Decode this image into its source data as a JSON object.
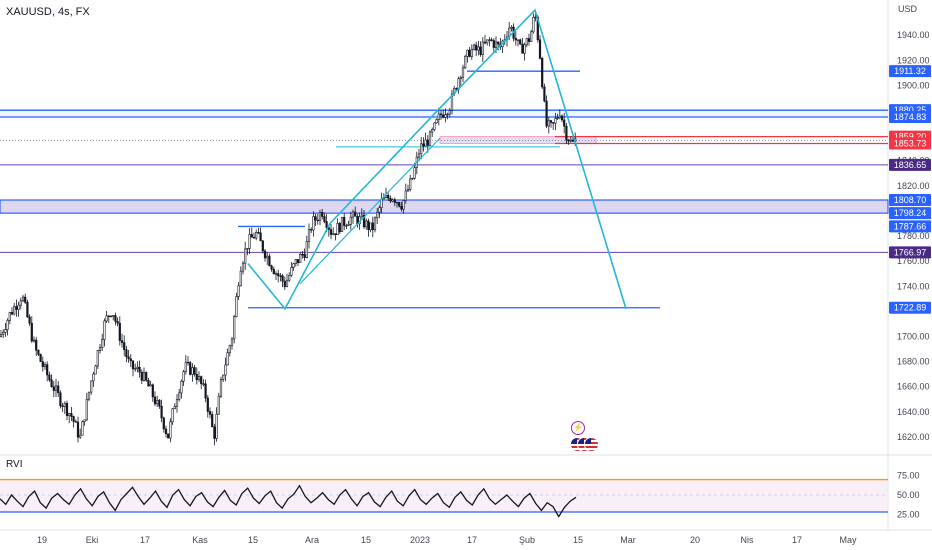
{
  "header": {
    "symbol_line": "XAUUSD, 4s, FX"
  },
  "currency_label": "USD",
  "indicator": {
    "name": "RVI"
  },
  "icons": [
    "lightning-icon",
    "us-flag-icon"
  ],
  "colors": {
    "candle": "#131722",
    "trend": "#22b7d9",
    "level_blue": "#2962ff",
    "level_red": "#f23645",
    "level_purple": "#6a3fb1",
    "zone_fill": "#d1c4e9",
    "rvi_line": "#131722",
    "rvi_upper": "#ff9800",
    "rvi_lower": "#2962ff"
  },
  "chart_data": {
    "type": "candlestick",
    "title": "XAUUSD, 4s, FX",
    "ylabel": "USD",
    "ylim": [
      1608,
      1968
    ],
    "y_ticks": [
      1620,
      1640,
      1660,
      1680,
      1700,
      1720,
      1740,
      1760,
      1780,
      1800,
      1820,
      1840,
      1860,
      1880,
      1900,
      1920,
      1940
    ],
    "y_tick_labels": [
      "1620.00",
      "1640.00",
      "1660.00",
      "1680.00",
      "1700.00",
      "",
      "1740.00",
      "1760.00",
      "1780.00",
      "",
      "1820.00",
      "1840.00",
      "",
      "",
      "1900.00",
      "1920.00",
      "1940.00"
    ],
    "x_ticks": [
      "19",
      "Eki",
      "17",
      "Kas",
      "15",
      "Ara",
      "15",
      "2023",
      "17",
      "Şub",
      "15",
      "Mar",
      "20",
      "Nis",
      "17",
      "May"
    ],
    "price_path": [
      [
        0,
        1700
      ],
      [
        10,
        1718
      ],
      [
        22,
        1733
      ],
      [
        35,
        1690
      ],
      [
        48,
        1668
      ],
      [
        60,
        1650
      ],
      [
        72,
        1636
      ],
      [
        80,
        1619
      ],
      [
        92,
        1668
      ],
      [
        105,
        1712
      ],
      [
        112,
        1722
      ],
      [
        120,
        1700
      ],
      [
        130,
        1676
      ],
      [
        140,
        1672
      ],
      [
        150,
        1658
      ],
      [
        160,
        1640
      ],
      [
        168,
        1620
      ],
      [
        175,
        1648
      ],
      [
        185,
        1676
      ],
      [
        195,
        1672
      ],
      [
        205,
        1655
      ],
      [
        214,
        1620
      ],
      [
        222,
        1668
      ],
      [
        232,
        1700
      ],
      [
        240,
        1755
      ],
      [
        248,
        1775
      ],
      [
        256,
        1782
      ],
      [
        265,
        1767
      ],
      [
        275,
        1752
      ],
      [
        285,
        1742
      ],
      [
        295,
        1758
      ],
      [
        305,
        1768
      ],
      [
        312,
        1790
      ],
      [
        322,
        1800
      ],
      [
        332,
        1782
      ],
      [
        342,
        1790
      ],
      [
        352,
        1795
      ],
      [
        362,
        1792
      ],
      [
        372,
        1785
      ],
      [
        382,
        1808
      ],
      [
        392,
        1812
      ],
      [
        402,
        1805
      ],
      [
        412,
        1825
      ],
      [
        420,
        1850
      ],
      [
        430,
        1858
      ],
      [
        440,
        1876
      ],
      [
        450,
        1884
      ],
      [
        460,
        1910
      ],
      [
        470,
        1928
      ],
      [
        480,
        1928
      ],
      [
        490,
        1936
      ],
      [
        500,
        1930
      ],
      [
        510,
        1948
      ],
      [
        520,
        1928
      ],
      [
        530,
        1938
      ],
      [
        535,
        1958
      ],
      [
        540,
        1924
      ],
      [
        546,
        1868
      ],
      [
        552,
        1866
      ],
      [
        560,
        1880
      ],
      [
        566,
        1862
      ],
      [
        572,
        1853
      ],
      [
        576,
        1857
      ]
    ],
    "levels": [
      {
        "value": 1911.32,
        "label": "1911.32",
        "kind": "line-blue"
      },
      {
        "value": 1880.25,
        "label": "1880.25",
        "kind": "line-blue"
      },
      {
        "value": 1874.83,
        "label": "1874.83",
        "kind": "line-blue"
      },
      {
        "value": 1859.2,
        "label": "1859.20",
        "kind": "line-red"
      },
      {
        "value": 1853.73,
        "label": "1853.73",
        "kind": "line-red"
      },
      {
        "value": 1836.65,
        "label": "1836.65",
        "kind": "line-purple"
      },
      {
        "value": 1808.7,
        "label": "1808.70",
        "kind": "zone-top"
      },
      {
        "value": 1798.24,
        "label": "1798.24",
        "kind": "zone-bottom"
      },
      {
        "value": 1787.66,
        "label": "1787.66",
        "kind": "line-blue"
      },
      {
        "value": 1766.97,
        "label": "1766.97",
        "kind": "line-purple"
      },
      {
        "value": 1722.89,
        "label": "1722.89",
        "kind": "line-blue"
      }
    ],
    "pattern_lines": [
      [
        [
          248,
          1758
        ],
        [
          285,
          1722
        ],
        [
          330,
          1790
        ],
        [
          440,
          1882
        ],
        [
          535,
          1960
        ],
        [
          626,
          1722
        ]
      ]
    ],
    "rvi": {
      "ylim": [
        15,
        85
      ],
      "ticks": [
        75,
        50,
        25
      ],
      "tick_labels": [
        "75.00",
        "50.00",
        "25.00"
      ],
      "upper": 70,
      "lower": 28,
      "values": [
        45,
        38,
        50,
        42,
        35,
        48,
        55,
        40,
        33,
        46,
        52,
        44,
        38,
        50,
        58,
        45,
        36,
        48,
        54,
        40,
        30,
        44,
        52,
        60,
        48,
        38,
        46,
        55,
        42,
        34,
        50,
        57,
        44,
        36,
        48,
        53,
        41,
        35,
        47,
        56,
        43,
        37,
        52,
        59,
        46,
        39,
        49,
        55,
        40,
        33,
        45,
        51,
        62,
        48,
        40,
        46,
        53,
        44,
        38,
        50,
        57,
        45,
        36,
        48,
        53,
        41,
        35,
        47,
        55,
        42,
        36,
        49,
        57,
        44,
        38,
        46,
        52,
        40,
        34,
        47,
        54,
        43,
        37,
        50,
        58,
        45,
        38,
        44,
        50,
        42,
        35,
        46,
        52,
        39,
        30,
        40,
        35,
        22,
        34,
        42,
        47
      ]
    }
  }
}
